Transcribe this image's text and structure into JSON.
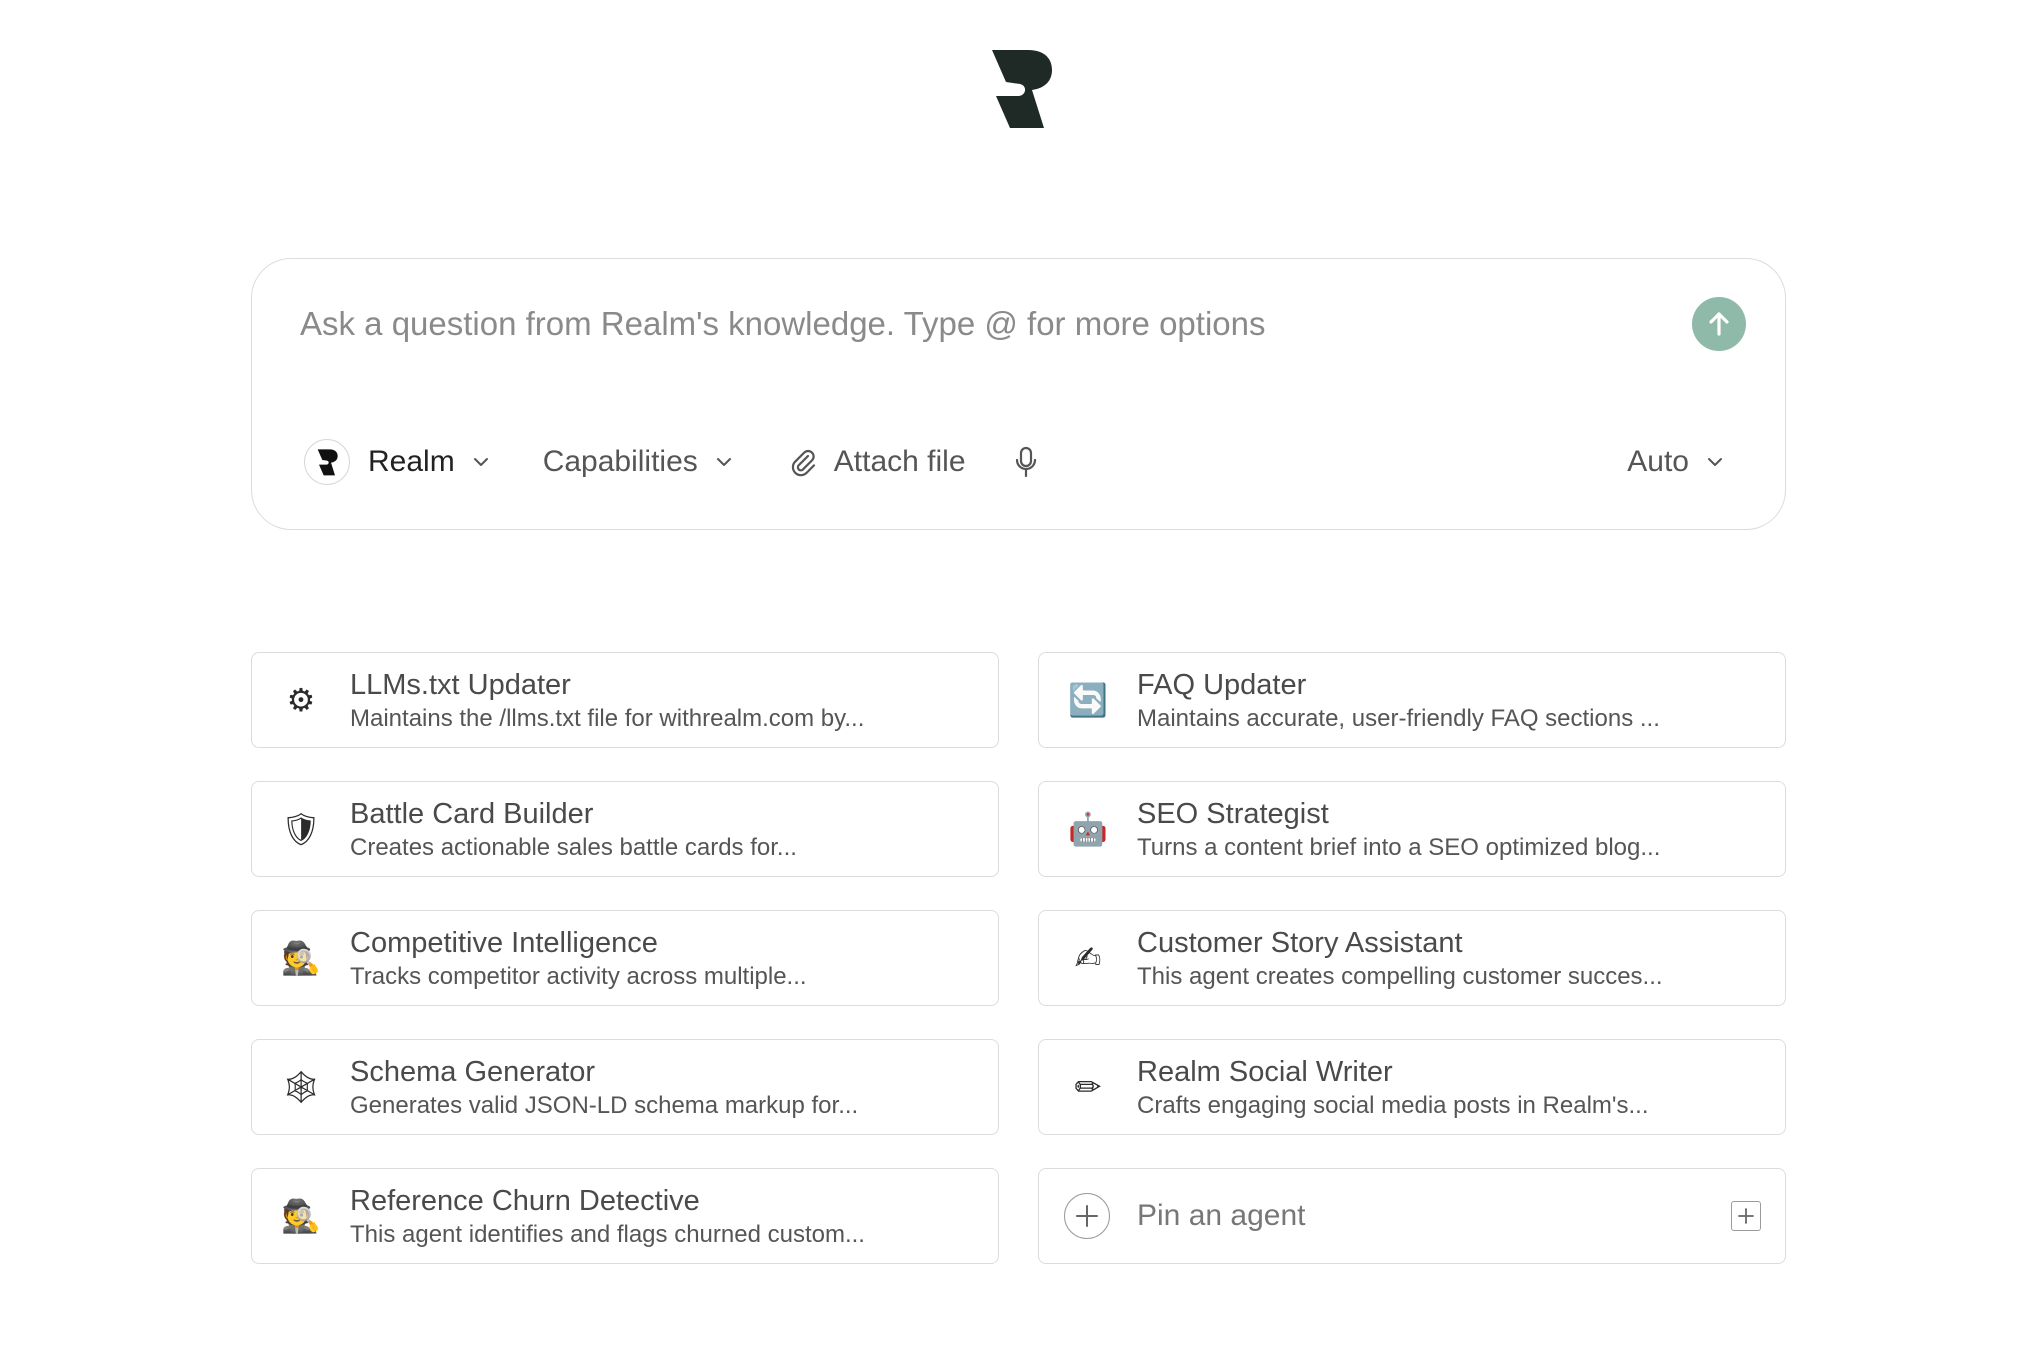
{
  "logo": {
    "icon": "realm-logo-icon"
  },
  "composer": {
    "placeholder": "Ask a question from Realm's knowledge. Type @ for more options",
    "send_icon": "arrow-up-icon",
    "accent_color": "#8fb9a8",
    "toolbar": {
      "source_label": "Realm",
      "capabilities_label": "Capabilities",
      "attach_label": "Attach file",
      "model_label": "Auto"
    }
  },
  "agents": [
    {
      "icon": "⚙",
      "icon_name": "gear-icon",
      "title": "LLMs.txt Updater",
      "description": "Maintains the /llms.txt file for withrealm.com by..."
    },
    {
      "icon": "🔄",
      "icon_name": "refresh-icon",
      "title": "FAQ Updater",
      "description": "Maintains accurate, user-friendly FAQ sections ..."
    },
    {
      "icon": "🛡",
      "icon_name": "shield-icon",
      "title": "Battle Card Builder",
      "description": "Creates actionable sales battle cards for..."
    },
    {
      "icon": "🤖",
      "icon_name": "robot-icon",
      "title": "SEO Strategist",
      "description": "Turns a content brief into a SEO optimized blog..."
    },
    {
      "icon": "🕵",
      "icon_name": "detective-icon",
      "title": "Competitive Intelligence",
      "description": "Tracks competitor activity across multiple..."
    },
    {
      "icon": "✍",
      "icon_name": "writing-hand-icon",
      "title": "Customer Story Assistant",
      "description": "This agent creates compelling customer succes..."
    },
    {
      "icon": "🕸",
      "icon_name": "spider-web-icon",
      "title": "Schema Generator",
      "description": "Generates valid JSON-LD schema markup for..."
    },
    {
      "icon": "✏",
      "icon_name": "pencil-icon",
      "title": "Realm Social Writer",
      "description": "Crafts engaging social media posts in Realm's..."
    },
    {
      "icon": "🕵",
      "icon_name": "detective-icon",
      "title": "Reference Churn Detective",
      "description": "This agent identifies and flags churned custom..."
    }
  ],
  "pin_agent": {
    "label": "Pin an agent"
  }
}
